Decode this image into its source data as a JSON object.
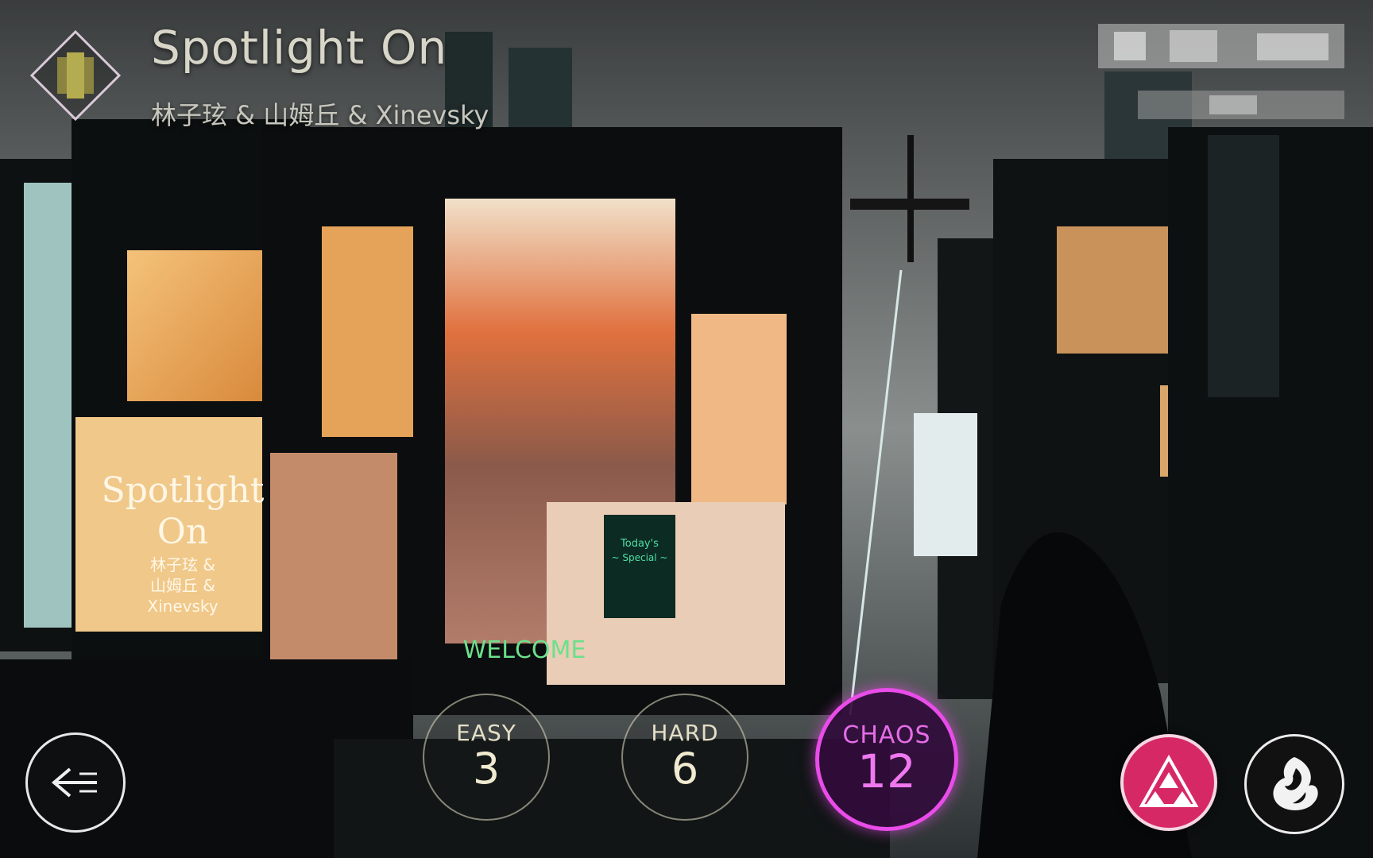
{
  "song": {
    "title": "Spotlight On",
    "artist": "林子玹 & 山姆丘 & Xinevsky"
  },
  "poster": {
    "title_line1": "Spotlight",
    "title_line2": "On",
    "artist_line1": "林子玹 &",
    "artist_line2": "山姆丘 &",
    "artist_line3": "Xinevsky"
  },
  "storefront": {
    "welcome_mat": "WELCOME",
    "chalkboard_line1": "Today's",
    "chalkboard_line2": "~ Special ~"
  },
  "difficulties": [
    {
      "name": "EASY",
      "level": "3"
    },
    {
      "name": "HARD",
      "level": "6"
    },
    {
      "name": "CHAOS",
      "level": "12"
    }
  ],
  "selected_difficulty": "CHAOS",
  "icons": {
    "back": "back-arrow-icon",
    "mode": "triforce-icon",
    "character": "flame-emblem-icon"
  },
  "colors": {
    "chaos_accent": "#e94ce8",
    "mode_button": "#d72866",
    "title_text": "#d8d6c8"
  }
}
